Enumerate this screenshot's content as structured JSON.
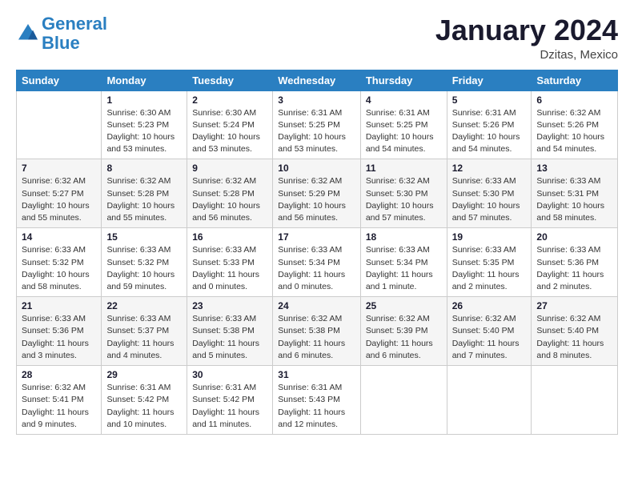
{
  "header": {
    "logo_line1": "General",
    "logo_line2": "Blue",
    "month": "January 2024",
    "location": "Dzitas, Mexico"
  },
  "weekdays": [
    "Sunday",
    "Monday",
    "Tuesday",
    "Wednesday",
    "Thursday",
    "Friday",
    "Saturday"
  ],
  "rows": [
    [
      {
        "day": "",
        "info": ""
      },
      {
        "day": "1",
        "info": "Sunrise: 6:30 AM\nSunset: 5:23 PM\nDaylight: 10 hours\nand 53 minutes."
      },
      {
        "day": "2",
        "info": "Sunrise: 6:30 AM\nSunset: 5:24 PM\nDaylight: 10 hours\nand 53 minutes."
      },
      {
        "day": "3",
        "info": "Sunrise: 6:31 AM\nSunset: 5:25 PM\nDaylight: 10 hours\nand 53 minutes."
      },
      {
        "day": "4",
        "info": "Sunrise: 6:31 AM\nSunset: 5:25 PM\nDaylight: 10 hours\nand 54 minutes."
      },
      {
        "day": "5",
        "info": "Sunrise: 6:31 AM\nSunset: 5:26 PM\nDaylight: 10 hours\nand 54 minutes."
      },
      {
        "day": "6",
        "info": "Sunrise: 6:32 AM\nSunset: 5:26 PM\nDaylight: 10 hours\nand 54 minutes."
      }
    ],
    [
      {
        "day": "7",
        "info": "Sunrise: 6:32 AM\nSunset: 5:27 PM\nDaylight: 10 hours\nand 55 minutes."
      },
      {
        "day": "8",
        "info": "Sunrise: 6:32 AM\nSunset: 5:28 PM\nDaylight: 10 hours\nand 55 minutes."
      },
      {
        "day": "9",
        "info": "Sunrise: 6:32 AM\nSunset: 5:28 PM\nDaylight: 10 hours\nand 56 minutes."
      },
      {
        "day": "10",
        "info": "Sunrise: 6:32 AM\nSunset: 5:29 PM\nDaylight: 10 hours\nand 56 minutes."
      },
      {
        "day": "11",
        "info": "Sunrise: 6:32 AM\nSunset: 5:30 PM\nDaylight: 10 hours\nand 57 minutes."
      },
      {
        "day": "12",
        "info": "Sunrise: 6:33 AM\nSunset: 5:30 PM\nDaylight: 10 hours\nand 57 minutes."
      },
      {
        "day": "13",
        "info": "Sunrise: 6:33 AM\nSunset: 5:31 PM\nDaylight: 10 hours\nand 58 minutes."
      }
    ],
    [
      {
        "day": "14",
        "info": "Sunrise: 6:33 AM\nSunset: 5:32 PM\nDaylight: 10 hours\nand 58 minutes."
      },
      {
        "day": "15",
        "info": "Sunrise: 6:33 AM\nSunset: 5:32 PM\nDaylight: 10 hours\nand 59 minutes."
      },
      {
        "day": "16",
        "info": "Sunrise: 6:33 AM\nSunset: 5:33 PM\nDaylight: 11 hours\nand 0 minutes."
      },
      {
        "day": "17",
        "info": "Sunrise: 6:33 AM\nSunset: 5:34 PM\nDaylight: 11 hours\nand 0 minutes."
      },
      {
        "day": "18",
        "info": "Sunrise: 6:33 AM\nSunset: 5:34 PM\nDaylight: 11 hours\nand 1 minute."
      },
      {
        "day": "19",
        "info": "Sunrise: 6:33 AM\nSunset: 5:35 PM\nDaylight: 11 hours\nand 2 minutes."
      },
      {
        "day": "20",
        "info": "Sunrise: 6:33 AM\nSunset: 5:36 PM\nDaylight: 11 hours\nand 2 minutes."
      }
    ],
    [
      {
        "day": "21",
        "info": "Sunrise: 6:33 AM\nSunset: 5:36 PM\nDaylight: 11 hours\nand 3 minutes."
      },
      {
        "day": "22",
        "info": "Sunrise: 6:33 AM\nSunset: 5:37 PM\nDaylight: 11 hours\nand 4 minutes."
      },
      {
        "day": "23",
        "info": "Sunrise: 6:33 AM\nSunset: 5:38 PM\nDaylight: 11 hours\nand 5 minutes."
      },
      {
        "day": "24",
        "info": "Sunrise: 6:32 AM\nSunset: 5:38 PM\nDaylight: 11 hours\nand 6 minutes."
      },
      {
        "day": "25",
        "info": "Sunrise: 6:32 AM\nSunset: 5:39 PM\nDaylight: 11 hours\nand 6 minutes."
      },
      {
        "day": "26",
        "info": "Sunrise: 6:32 AM\nSunset: 5:40 PM\nDaylight: 11 hours\nand 7 minutes."
      },
      {
        "day": "27",
        "info": "Sunrise: 6:32 AM\nSunset: 5:40 PM\nDaylight: 11 hours\nand 8 minutes."
      }
    ],
    [
      {
        "day": "28",
        "info": "Sunrise: 6:32 AM\nSunset: 5:41 PM\nDaylight: 11 hours\nand 9 minutes."
      },
      {
        "day": "29",
        "info": "Sunrise: 6:31 AM\nSunset: 5:42 PM\nDaylight: 11 hours\nand 10 minutes."
      },
      {
        "day": "30",
        "info": "Sunrise: 6:31 AM\nSunset: 5:42 PM\nDaylight: 11 hours\nand 11 minutes."
      },
      {
        "day": "31",
        "info": "Sunrise: 6:31 AM\nSunset: 5:43 PM\nDaylight: 11 hours\nand 12 minutes."
      },
      {
        "day": "",
        "info": ""
      },
      {
        "day": "",
        "info": ""
      },
      {
        "day": "",
        "info": ""
      }
    ]
  ]
}
